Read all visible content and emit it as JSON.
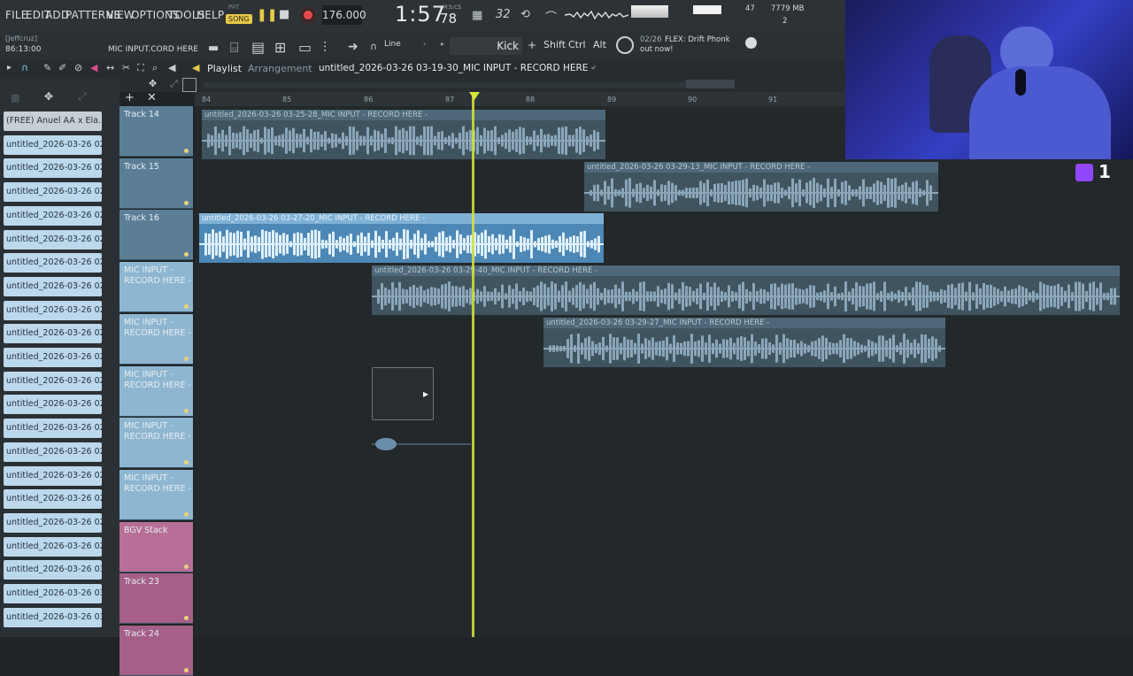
{
  "menu": [
    "FILE",
    "EDIT",
    "ADD",
    "PATTERNS",
    "VIEW",
    "OPTIONS",
    "TOOLS",
    "HELP"
  ],
  "transport": {
    "pat": "PAT",
    "song": "SONG",
    "tempo": "176.000",
    "time": "1:57",
    "time_sub": "78",
    "time_unit": "M:S:CS",
    "beats": "32",
    "cpu": "47",
    "memory": "7779 MB",
    "voices": "2"
  },
  "toolbar": {
    "user": "[Jeffcruz]",
    "position": "86:13:00",
    "hint": "MIC INPUT.CORD HERE",
    "snap": "Line",
    "channel": "Kick",
    "shift": "Shift",
    "ctrl": "Ctrl",
    "alt": "Alt",
    "news_date": "02/26",
    "news": "FLEX: Drift Phonk",
    "news2": "out now!"
  },
  "playlist": {
    "title": "Playlist",
    "subtitle": "Arrangement",
    "pattern": "untitled_2026-03-26 03-19-30_MIC INPUT - RECORD HERE -"
  },
  "ruler": [
    "84",
    "85",
    "86",
    "87",
    "88",
    "89",
    "90",
    "91"
  ],
  "browser": [
    "(FREE) Anuel AA x Ela...",
    "untitled_2026-03-26 02-",
    "untitled_2026-03-26 02-",
    "untitled_2026-03-26 02-",
    "untitled_2026-03-26 02-",
    "untitled_2026-03-26 02-",
    "untitled_2026-03-26 02-",
    "untitled_2026-03-26 02-",
    "untitled_2026-03-26 02-",
    "untitled_2026-03-26 02-",
    "untitled_2026-03-26 02-",
    "untitled_2026-03-26 02-",
    "untitled_2026-03-26 02-",
    "untitled_2026-03-26 02-",
    "untitled_2026-03-26 02-",
    "untitled_2026-03-26 02-",
    "untitled_2026-03-26 02-",
    "untitled_2026-03-26 02-",
    "untitled_2026-03-26 02-",
    "untitled_2026-03-26 03-",
    "untitled_2026-03-26 03-",
    "untitled_2026-03-26 03-"
  ],
  "tracks": [
    {
      "name": "Track 14"
    },
    {
      "name": "Track 15"
    },
    {
      "name": "Track 16"
    },
    {
      "name": "MIC INPUT -\nRECORD HERE -"
    },
    {
      "name": "MIC INPUT -\nRECORD HERE -"
    },
    {
      "name": "MIC INPUT -\nRECORD HERE -"
    },
    {
      "name": "MIC INPUT -\nRECORD HERE -"
    },
    {
      "name": "MIC INPUT -\nRECORD HERE -"
    },
    {
      "name": "BGV Stack"
    },
    {
      "name": "Track 23"
    },
    {
      "name": "Track 24"
    }
  ],
  "clips": [
    "untitled_2026-03-26 03-25-28_MIC INPUT - RECORD HERE -",
    "untitled_2026-03-26 03-29-13_MIC INPUT - RECORD HERE -",
    "untitled_2026-03-26 03-27-20_MIC INPUT - RECORD HERE -",
    "untitled_2026-03-26 03-29-40_MIC INPUT - RECORD HERE -",
    "untitled_2026-03-26 03-29-27_MIC INPUT - RECORD HERE -"
  ],
  "twitch_count": "1"
}
